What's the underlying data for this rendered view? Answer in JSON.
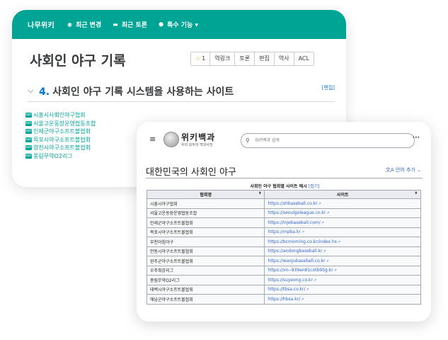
{
  "namuwiki": {
    "logo": "나무위키",
    "nav": [
      {
        "icon": "compass-icon",
        "glyph": "◉",
        "label": "최근 변경"
      },
      {
        "icon": "comment-icon",
        "glyph": "▬",
        "label": "최근 토론"
      },
      {
        "icon": "cube-icon",
        "glyph": "⬢",
        "label": "특수 기능 ▾"
      }
    ],
    "title": "사회인 야구 기록",
    "tools": {
      "star": "☆",
      "star_count": "1",
      "backlinks": "역링크",
      "discuss": "토론",
      "edit": "편집",
      "history": "역사",
      "acl": "ACL"
    },
    "section": {
      "number": "4.",
      "title": "사회인 야구 기록 시스템을 사용하는 사이트",
      "edit_label": "[편집]"
    },
    "ext_badge": "ext",
    "links": [
      "시흥시사회인야구협회",
      "서울고운동장운영협동조합",
      "인제군야구소프트볼협회",
      "목포시야구소프트볼협회",
      "영천시야구소프트볼협회",
      "풍림무약O2리그"
    ],
    "accent": "#00A495"
  },
  "wikipedia": {
    "menu_icon": "≡",
    "logo_title": "위키백과",
    "logo_sub": "우리 모두의 백과사전",
    "search_placeholder": "위키백과 검색",
    "more_icon": "···",
    "title": "대한민국의 사회인 야구",
    "lang_button": "文A 언어 추가 ⌄",
    "table_caption": "사회인 야구 협회별 사이트 예시",
    "table_caption_hide": "[접기]",
    "col_name": "협회명",
    "col_site": "사이트",
    "sort_icon": "⬍",
    "ext_arrow": "↗",
    "rows": [
      {
        "name": "시흥시야구협회",
        "url": "https://shbaseball.co.kr"
      },
      {
        "name": "서울고운동장운영협동조합",
        "url": "https://seoulgoleague.co.kr"
      },
      {
        "name": "인제군야구소프트볼협회",
        "url": "https://injebaseball.com/"
      },
      {
        "name": "목포시야구소프트볼협회",
        "url": "https://mpba.kr"
      },
      {
        "name": "부천야침야구",
        "url": "https://bcmorning.co.kr/index.hs"
      },
      {
        "name": "안동시야구소프트볼협회",
        "url": "https://andongbaseball.kr"
      },
      {
        "name": "완주군야구소프트볼협회",
        "url": "https://wanjubaseball.co.kr"
      },
      {
        "name": "우주최강리그",
        "url": "https://xn--939an81cotb95g.kr"
      },
      {
        "name": "풍림무약O2리그",
        "url": "https://suyeong.co.kr"
      },
      {
        "name": "태백시야구소프트볼협회",
        "url": "https://tbsa.co.kr/"
      },
      {
        "name": "해남군야구소프트볼협회",
        "url": "https://hbsa.kr/"
      }
    ],
    "link_color": "#3366cc"
  }
}
